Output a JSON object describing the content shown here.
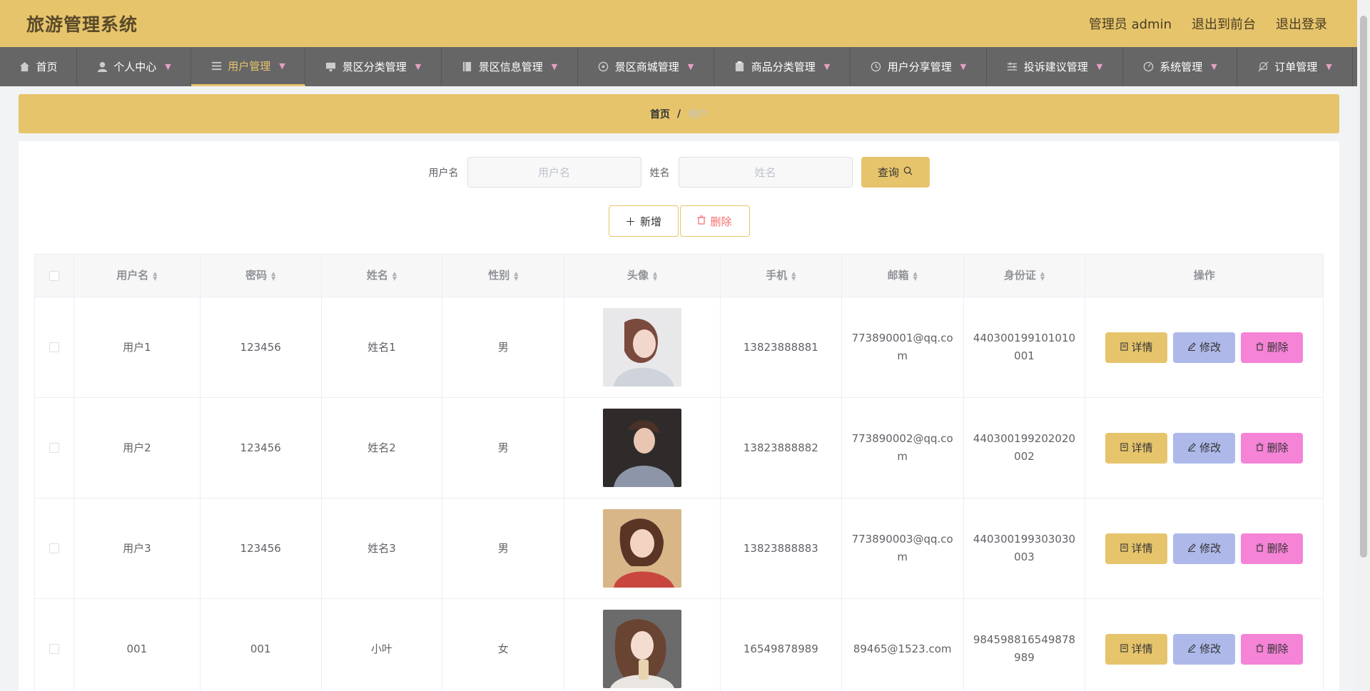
{
  "header": {
    "brand": "旅游管理系统",
    "admin_label": "管理员 admin",
    "front_label": "退出到前台",
    "logout_label": "退出登录"
  },
  "nav": {
    "items": [
      {
        "label": "首页",
        "icon": "home-icon"
      },
      {
        "label": "个人中心",
        "icon": "user-icon"
      },
      {
        "label": "用户管理",
        "icon": "list-icon"
      },
      {
        "label": "景区分类管理",
        "icon": "monitor-icon"
      },
      {
        "label": "景区信息管理",
        "icon": "notebook-icon"
      },
      {
        "label": "景区商城管理",
        "icon": "target-icon"
      },
      {
        "label": "商品分类管理",
        "icon": "clipboard-icon"
      },
      {
        "label": "用户分享管理",
        "icon": "clock-icon"
      },
      {
        "label": "投诉建议管理",
        "icon": "sliders-icon"
      },
      {
        "label": "系统管理",
        "icon": "gauge-icon"
      },
      {
        "label": "订单管理",
        "icon": "bell-off-icon"
      }
    ],
    "active_index": 2
  },
  "breadcrumb": {
    "home": "首页",
    "sep": "/",
    "current": "用户"
  },
  "search": {
    "username_label": "用户名",
    "username_placeholder": "用户名",
    "name_label": "姓名",
    "name_placeholder": "姓名",
    "query_label": "查询"
  },
  "actions": {
    "add_label": "新增",
    "delete_label": "删除"
  },
  "table": {
    "headers": [
      "用户名",
      "密码",
      "姓名",
      "性别",
      "头像",
      "手机",
      "邮箱",
      "身份证",
      "操作"
    ],
    "rows": [
      {
        "username": "用户1",
        "password": "123456",
        "name": "姓名1",
        "gender": "男",
        "phone": "13823888881",
        "email": "773890001@qq.com",
        "idcard": "440300199101010001"
      },
      {
        "username": "用户2",
        "password": "123456",
        "name": "姓名2",
        "gender": "男",
        "phone": "13823888882",
        "email": "773890002@qq.com",
        "idcard": "440300199202020002"
      },
      {
        "username": "用户3",
        "password": "123456",
        "name": "姓名3",
        "gender": "男",
        "phone": "13823888883",
        "email": "773890003@qq.com",
        "idcard": "440300199303030003"
      },
      {
        "username": "001",
        "password": "001",
        "name": "小叶",
        "gender": "女",
        "phone": "16549878989",
        "email": "89465@1523.com",
        "idcard": "984598816549878989"
      }
    ],
    "row_actions": {
      "detail": "详情",
      "edit": "修改",
      "delete": "删除"
    }
  },
  "colors": {
    "accent": "#e6c46c",
    "nav_bg": "#666666",
    "edit": "#aeb9ea",
    "delete": "#f583d6"
  }
}
